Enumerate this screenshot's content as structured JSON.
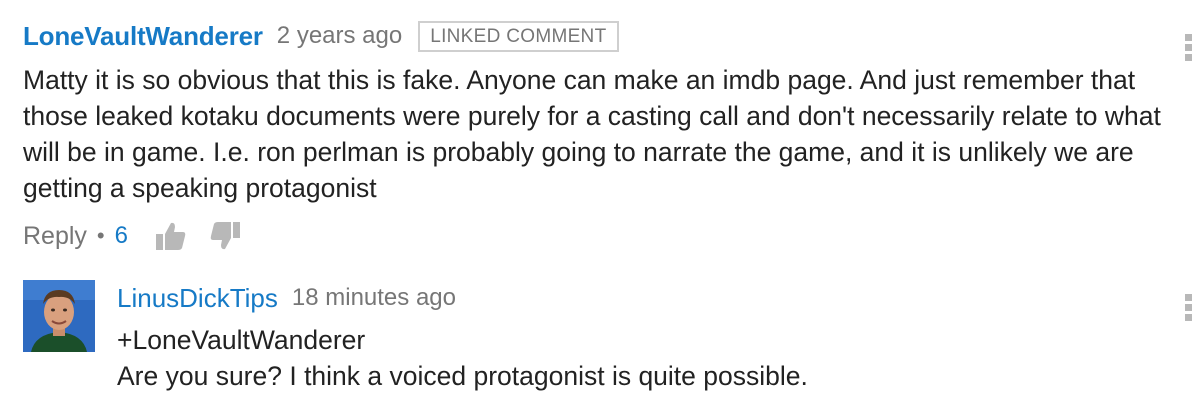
{
  "comment": {
    "author": "LoneVaultWanderer",
    "time": "2 years ago",
    "badge": "LINKED COMMENT",
    "body": "Matty it is so obvious that this is fake. Anyone can make an imdb page. And just remember that those leaked kotaku documents were purely for a casting call and don't necessarily relate to what will be in game. I.e. ron perlman is probably going to narrate the game, and it is unlikely we are getting a speaking protagonist",
    "reply_label": "Reply",
    "separator": "•",
    "like_count": "6",
    "icons": [
      "thumbs-up-icon",
      "thumbs-down-icon",
      "more-options-icon"
    ]
  },
  "reply": {
    "author": "LinusDickTips",
    "time": "18 minutes ago",
    "mention": "+LoneVaultWanderer",
    "body": "Are you sure? I think a voiced protagonist is quite possible.",
    "icons": [
      "avatar",
      "more-options-icon"
    ]
  },
  "colors": {
    "author_blue": "#167ac6",
    "meta_gray": "#767676",
    "text": "#222222",
    "icon_gray": "#b8b8b8"
  }
}
